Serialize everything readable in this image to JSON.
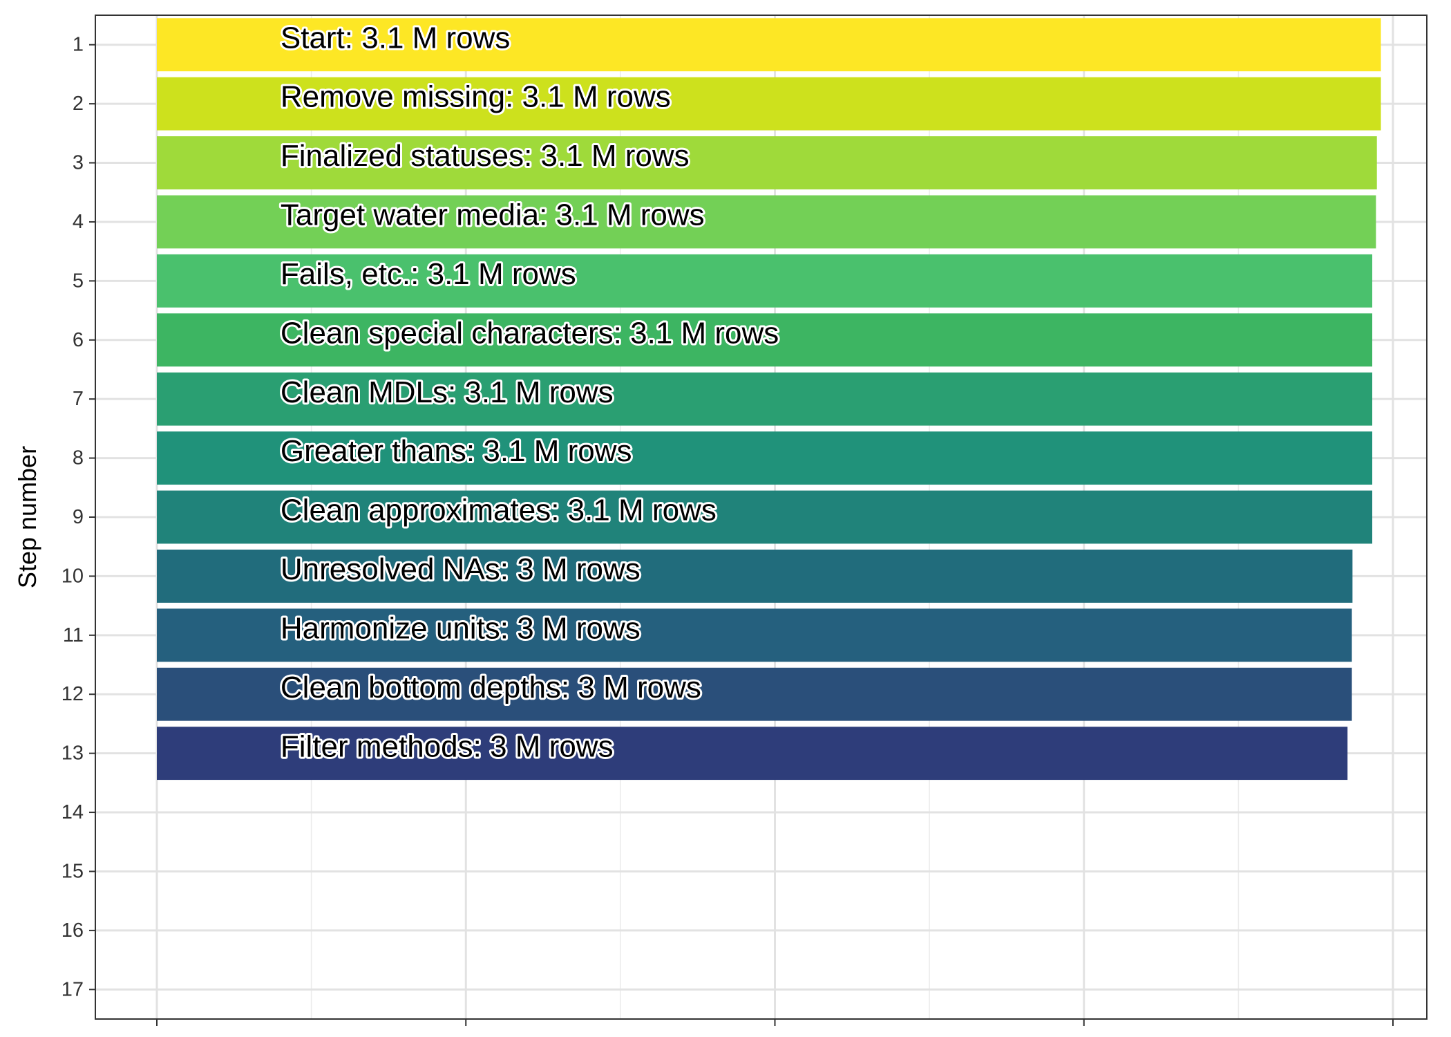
{
  "chart_data": {
    "type": "bar",
    "orientation": "horizontal",
    "ylabel": "Step number",
    "xlabel": "",
    "x_tick_labels_shown": false,
    "grid": true,
    "legend": "none",
    "ylim": [
      0.5,
      17.5
    ],
    "y_ticks": [
      1,
      2,
      3,
      4,
      5,
      6,
      7,
      8,
      9,
      10,
      11,
      12,
      13,
      14,
      15,
      16,
      17
    ],
    "xlim": [
      0,
      4.0
    ],
    "x_ticks": [
      0,
      1,
      2,
      3,
      4
    ],
    "categories": [
      1,
      2,
      3,
      4,
      5,
      6,
      7,
      8,
      9,
      10,
      11,
      12,
      13
    ],
    "values": [
      3.961,
      3.961,
      3.948,
      3.945,
      3.933,
      3.933,
      3.933,
      3.933,
      3.933,
      3.869,
      3.867,
      3.867,
      3.853
    ],
    "labels": [
      "Start:  3.1 M rows",
      "Remove missing:  3.1 M rows",
      "Finalized statuses:  3.1 M rows",
      "Target water media:  3.1 M rows",
      "Fails, etc.:  3.1 M rows",
      "Clean special characters:  3.1 M rows",
      "Clean MDLs:  3.1 M rows",
      "Greater thans:  3.1 M rows",
      "Clean approximates:  3.1 M rows",
      "Unresolved NAs:  3 M rows",
      "Harmonize units:  3 M rows",
      "Clean bottom depths:  3 M rows",
      "Filter methods:  3 M rows"
    ],
    "colors": [
      "#FDE725",
      "#CDE11D",
      "#9FDA3A",
      "#73D056",
      "#4AC16D",
      "#3DB562",
      "#2A9F72",
      "#20927A",
      "#20837A",
      "#216C7C",
      "#25607E",
      "#2A4F7A",
      "#2E3D7A"
    ]
  }
}
